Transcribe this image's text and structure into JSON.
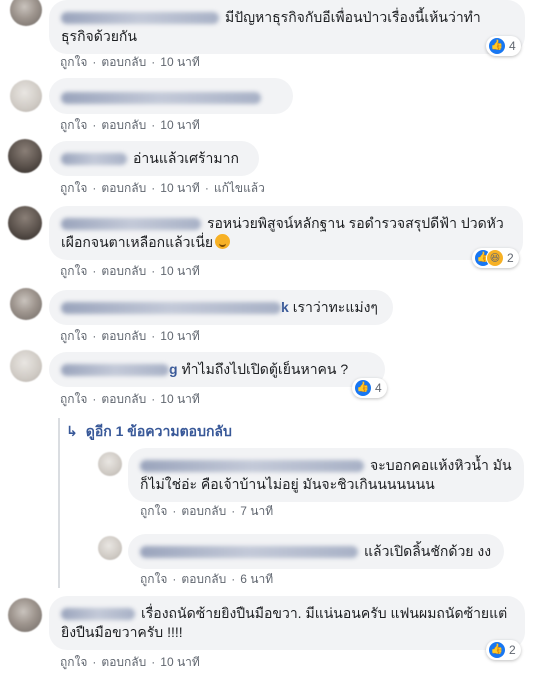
{
  "actions": {
    "like": "ถูกใจ",
    "reply": "ตอบกลับ",
    "dot": "·"
  },
  "comments": [
    {
      "author_visible": "",
      "text": "มีปัญหาธุรกิจกับอีเพื่อนป่าวเรื่องนี้เห้นว่าทำธุรกิจด้วยกัน",
      "time": "10 นาที",
      "likes": "4"
    },
    {
      "author_visible": "",
      "text": "",
      "time": "10 นาที"
    },
    {
      "author_visible": "",
      "text": "อ่านแล้วเศร้ามาก",
      "time": "10 นาที",
      "edited": "แก้ไขแล้ว"
    },
    {
      "author_visible": "",
      "text": "รอหน่วยพิสูจน์หลักฐาน รอดำรวจสรุปดีฟ้า ปวดหัวเผือกจนตาเหลือกแล้วเนี่ย",
      "time": "10 นาที",
      "likes": "2"
    },
    {
      "author_visible": "k",
      "text": "เราว่าทะแม่งๆ",
      "time": "10 นาที"
    },
    {
      "author_visible": "g",
      "text": "ทำไมถึงไปเปิดตู้เย็นหาคน ?",
      "time": "10 นาที",
      "likes": "4"
    }
  ],
  "view_replies": "ดูอีก 1 ข้อความตอบกลับ",
  "replies": [
    {
      "author_visible": "",
      "text": "จะบอกคอแห้งหิวน้ำ มันก็ไม่ใช่อ่ะ คือเจ้าบ้านไม่อยู่ มันจะชิวเกินนนนนนน",
      "time": "7 นาที"
    },
    {
      "author_visible": "",
      "text": "แล้วเปิดลิ้นชักด้วย งง",
      "time": "6 นาที"
    }
  ],
  "last_comment": {
    "author_visible": "",
    "text": "เรื่องถนัดซ้ายยิงปืนมือขวา. มีแน่นอนครับ แฟนผมถนัดซ้ายแต่ยิงปืนมือขวาครับ !!!!",
    "time": "10 นาที",
    "likes": "2"
  },
  "icons": {
    "like": "like-icon",
    "haha": "haha-icon",
    "reply_arrow": "reply-arrow-icon"
  },
  "colors": {
    "bubble": "#f2f3f5",
    "link": "#385898",
    "like_blue": "#1877f2",
    "meta": "#616770"
  }
}
